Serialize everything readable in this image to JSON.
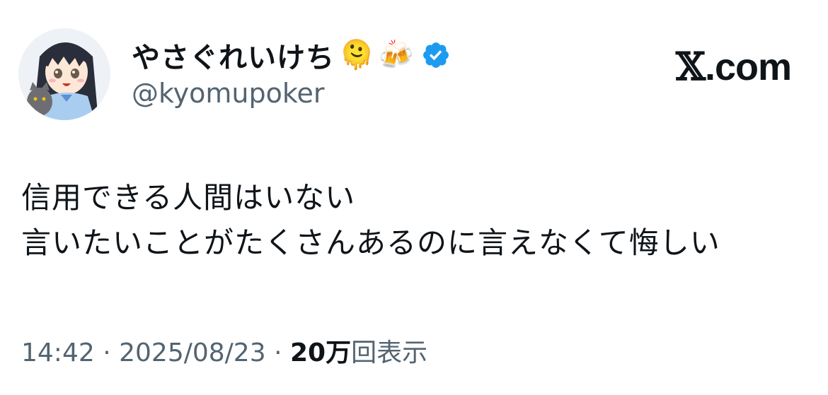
{
  "profile": {
    "display_name": "やさぐれいけち",
    "emoji_1": "🫠",
    "emoji_2": "🍻",
    "verified_icon": "verified-badge-icon",
    "handle": "@kyomupoker"
  },
  "brand": {
    "mark": "𝕏",
    "domain": ".com"
  },
  "tweet": {
    "lines": [
      "信用できる人間はいない",
      "言いたいことがたくさんあるのに言えなくて悔しい"
    ]
  },
  "meta": {
    "time": "14:42",
    "separator": "·",
    "date": "2025/08/23",
    "views_count": "20万",
    "views_label": "回表示"
  },
  "colors": {
    "text_primary": "#0f1419",
    "text_secondary": "#536471",
    "verified_blue": "#1d9bf0"
  }
}
